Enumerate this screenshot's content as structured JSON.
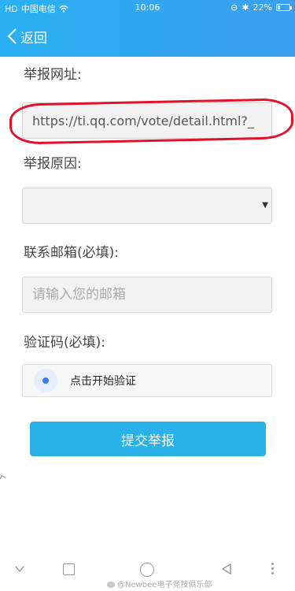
{
  "status_bar": {
    "carrier": "中国电信",
    "signal_label": "HD",
    "time": "10:06",
    "battery_percent": "22%",
    "battery_level": 0.22
  },
  "nav": {
    "back_label": "返回"
  },
  "form": {
    "url_label": "举报网址:",
    "url_value": "https://ti.qq.com/vote/detail.html?_",
    "reason_label": "举报原因:",
    "reason_value": "",
    "email_label": "联系邮箱(必填):",
    "email_placeholder": "请输入您的邮箱",
    "captcha_label": "验证码(必填):",
    "captcha_button": "点击开始验证",
    "submit_label": "提交举报"
  },
  "watermark": "@Newbee电子竞技俱乐部",
  "colors": {
    "header": "#2ab0f3",
    "submit": "#29b1ea",
    "annotation": "#e3122a"
  }
}
